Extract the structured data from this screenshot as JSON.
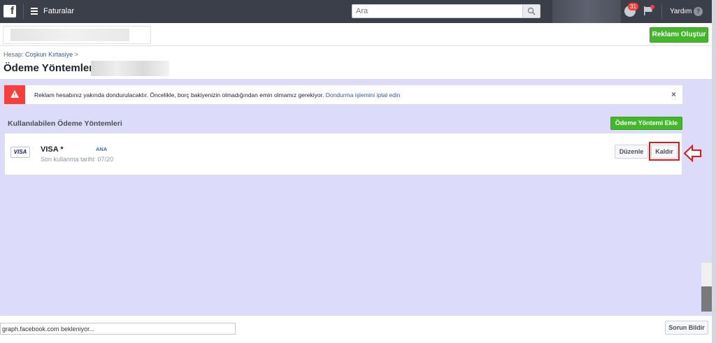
{
  "topbar": {
    "logo": "f",
    "title": "Faturalar",
    "search_placeholder": "Ara",
    "notification_count": "31",
    "help_label": "Yardım",
    "help_icon_glyph": "?"
  },
  "subbar": {
    "create_ad_label": "Reklamı Oluştur"
  },
  "header": {
    "breadcrumb_prefix": "Hesap:",
    "breadcrumb_account": "Coşkun Kırtasiye",
    "breadcrumb_chevron": ">",
    "page_title": "Ödeme Yöntemleri:"
  },
  "alert": {
    "text": "Reklam hesabınız yakında dondurulacaktır. Öncelikle, borç bakiyenizin olmadığından emin olmamız gerekiyor.",
    "link": "Dondurma işlemini iptal edin",
    "close": "×"
  },
  "payment_methods": {
    "section_title": "Kullanılabilen Ödeme Yöntemleri",
    "add_label": "Ödeme Yöntemi Ekle",
    "card": {
      "logo_text": "VISA",
      "name": "VISA *",
      "badge": "ANA",
      "expiry": "Son kullanma tarihi: 07/20",
      "edit_label": "Düzenle",
      "remove_label": "Kaldır"
    }
  },
  "footer": {
    "status_text": "graph.facebook.com bekleniyor...",
    "report_label": "Sorun Bildir"
  },
  "colors": {
    "topbar": "#3b3f4a",
    "accent_green": "#42b72a",
    "alert_red": "#fa3e3e",
    "link_blue": "#365899",
    "main_background": "#dcdcfa",
    "annotation_red": "#e0191e"
  }
}
